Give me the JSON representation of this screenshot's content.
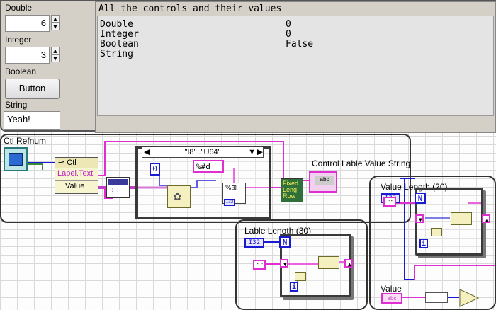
{
  "front_panel": {
    "double": {
      "label": "Double",
      "value": "6"
    },
    "integer": {
      "label": "Integer",
      "value": "3"
    },
    "boolean": {
      "label": "Boolean",
      "button_text": "Button"
    },
    "string": {
      "label": "String",
      "value": "Yeah!"
    },
    "indicator": {
      "title": "All the controls and their values",
      "rows": [
        {
          "name": "Double",
          "value": "0"
        },
        {
          "name": "Integer",
          "value": "0"
        },
        {
          "name": "Boolean",
          "value": "False"
        },
        {
          "name": "String",
          "value": ""
        }
      ]
    }
  },
  "block_diagram": {
    "ctl_refnum_label": "Ctl Refnum",
    "property_node": {
      "class": "Ctl",
      "properties": [
        "Label.Text",
        "Value"
      ]
    },
    "case_selector": "\"I8\"..\"U64\"",
    "const_zero": "0",
    "format_string": "%#d",
    "type_tag_i32": "I32",
    "fixed_length_row": "Fixed Leng Row",
    "output_label": "Control Lable Value String",
    "output_tag": "abc",
    "subvi_value_length": {
      "title": "Value Length (20)",
      "tag": "I32",
      "n": "N",
      "i": "i",
      "empty_string": "\"\""
    },
    "subvi_label_length": {
      "title": "Lable Length (30)",
      "tag": "I32",
      "n": "N",
      "i": "i",
      "empty_string": "\"\""
    },
    "value_terminal": {
      "label": "Value",
      "tag": "abc"
    },
    "colors": {
      "string_wire": "#e02fd0",
      "int_wire": "#1a1ad0",
      "structure": "#3a3a3a"
    }
  }
}
